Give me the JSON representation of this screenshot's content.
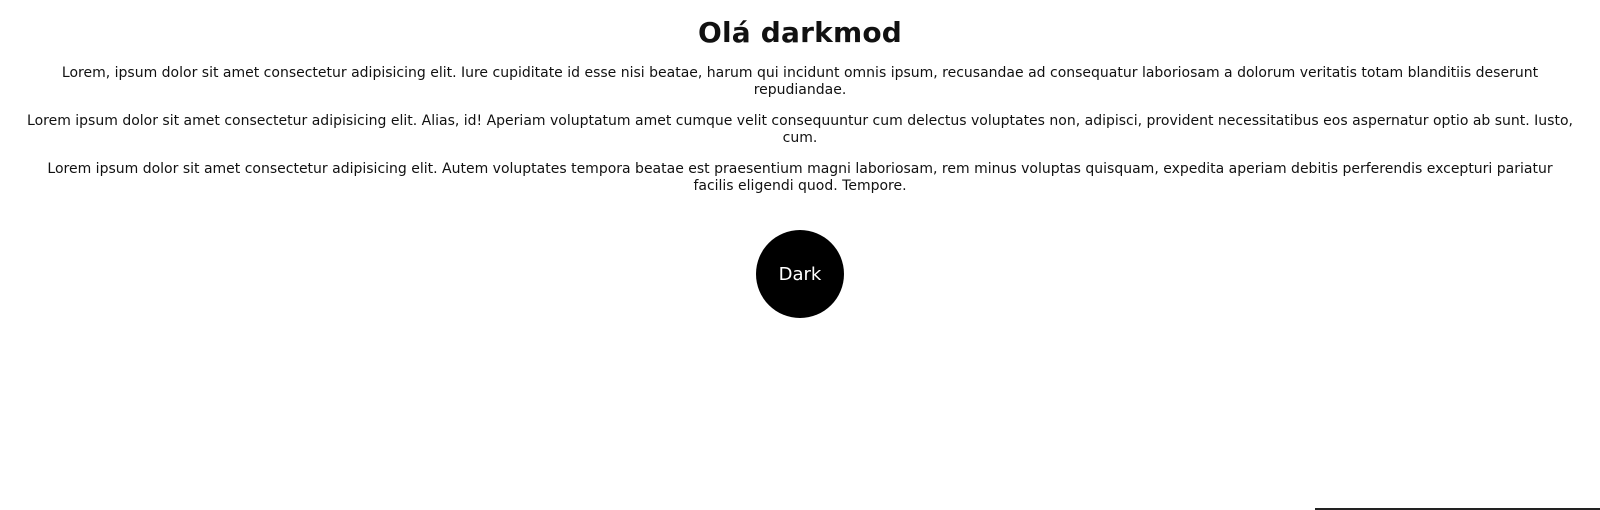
{
  "header": {
    "title": "Olá darkmod"
  },
  "main": {
    "paragraphs": [
      "Lorem, ipsum dolor sit amet consectetur adipisicing elit. Iure cupiditate id esse nisi beatae, harum qui incidunt omnis ipsum, recusandae ad consequatur laboriosam a dolorum veritatis totam blanditiis deserunt repudiandae.",
      "Lorem ipsum dolor sit amet consectetur adipisicing elit. Alias, id! Aperiam voluptatum amet cumque velit consequuntur cum delectus voluptates non, adipisci, provident necessitatibus eos aspernatur optio ab sunt. Iusto, cum.",
      "Lorem ipsum dolor sit amet consectetur adipisicing elit. Autem voluptates tempora beatae est praesentium magni laboriosam, rem minus voluptas quisquam, expedita aperiam debitis perferendis excepturi pariatur facilis eligendi quod. Tempore."
    ]
  },
  "toggle": {
    "label": "Dark",
    "background": "#000000",
    "text_color": "#ffffff"
  }
}
